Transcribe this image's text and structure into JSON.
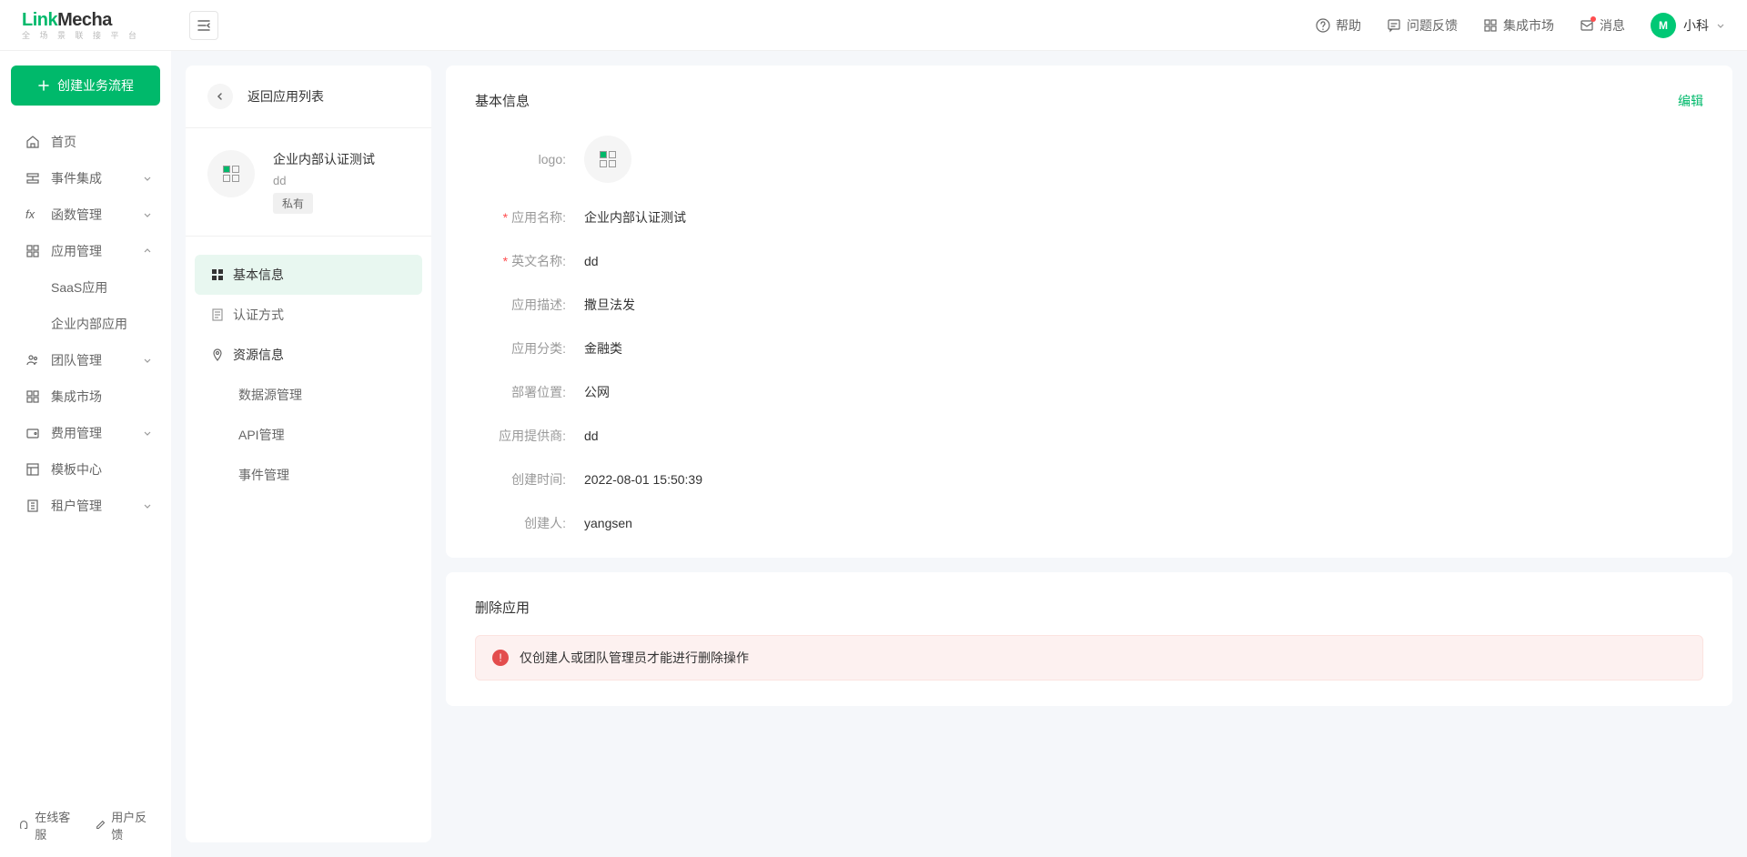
{
  "brand": {
    "name": "LinkMecha",
    "sub": "全 场 景 联 接 平 台"
  },
  "header": {
    "help": "帮助",
    "feedback": "问题反馈",
    "market": "集成市场",
    "message": "消息",
    "user": "小科"
  },
  "sidebar": {
    "create": "创建业务流程",
    "items": [
      {
        "label": "首页"
      },
      {
        "label": "事件集成"
      },
      {
        "label": "函数管理"
      },
      {
        "label": "应用管理"
      },
      {
        "label": "团队管理"
      },
      {
        "label": "集成市场"
      },
      {
        "label": "费用管理"
      },
      {
        "label": "模板中心"
      },
      {
        "label": "租户管理"
      }
    ],
    "sub_saas": "SaaS应用",
    "sub_internal": "企业内部应用",
    "footer": {
      "cs": "在线客服",
      "fb": "用户反馈"
    }
  },
  "subpanel": {
    "back": "返回应用列表",
    "app": {
      "name": "企业内部认证测试",
      "code": "dd",
      "tag": "私有"
    },
    "nav": {
      "basic": "基本信息",
      "auth": "认证方式",
      "resource": "资源信息",
      "datasource": "数据源管理",
      "api": "API管理",
      "event": "事件管理"
    }
  },
  "content": {
    "basic_title": "基本信息",
    "edit": "编辑",
    "labels": {
      "logo": "logo:",
      "name": "应用名称:",
      "en_name": "英文名称:",
      "desc": "应用描述:",
      "category": "应用分类:",
      "deploy": "部署位置:",
      "provider": "应用提供商:",
      "created_at": "创建时间:",
      "creator": "创建人:"
    },
    "values": {
      "name": "企业内部认证测试",
      "en_name": "dd",
      "desc": "撒旦法发",
      "category": "金融类",
      "deploy": "公网",
      "provider": "dd",
      "created_at": "2022-08-01 15:50:39",
      "creator": "yangsen"
    },
    "delete_title": "删除应用",
    "delete_alert": "仅创建人或团队管理员才能进行删除操作"
  }
}
